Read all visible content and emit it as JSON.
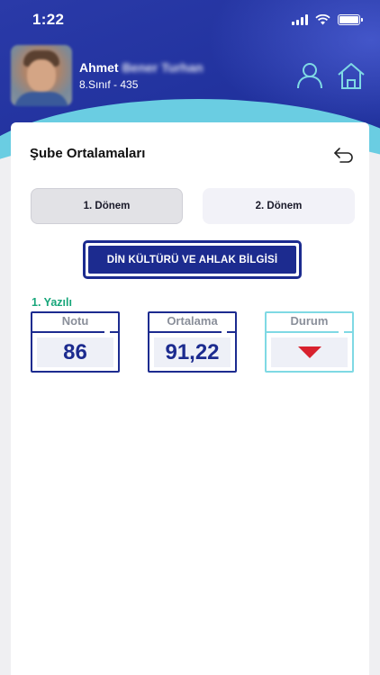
{
  "status_bar": {
    "time": "1:22"
  },
  "profile": {
    "first_name": "Ahmet",
    "surname_blurred": "Bener Turhan",
    "class_info": "8.Sınıf - 435"
  },
  "page": {
    "title": "Şube Ortalamaları"
  },
  "terms": [
    {
      "label": "1. Dönem",
      "selected": true
    },
    {
      "label": "2. Dönem",
      "selected": false
    }
  ],
  "subject": {
    "label": "DİN KÜLTÜRÜ VE AHLAK BİLGİSİ"
  },
  "exam": {
    "title": "1. Yazılı",
    "grade_label": "Notu",
    "grade_value": "86",
    "average_label": "Ortalama",
    "average_value": "91,22",
    "status_label": "Durum",
    "status": "below-average",
    "status_icon": "red-down-triangle-icon"
  },
  "colors": {
    "primary": "#1c2b8f",
    "accent_cyan": "#7fd9e4",
    "exam_title_green": "#17a67a",
    "status_down_red": "#d8222e"
  },
  "icons": [
    "profile-icon",
    "home-icon",
    "back-arrow-icon",
    "wifi-icon",
    "signal-icon",
    "battery-icon"
  ]
}
